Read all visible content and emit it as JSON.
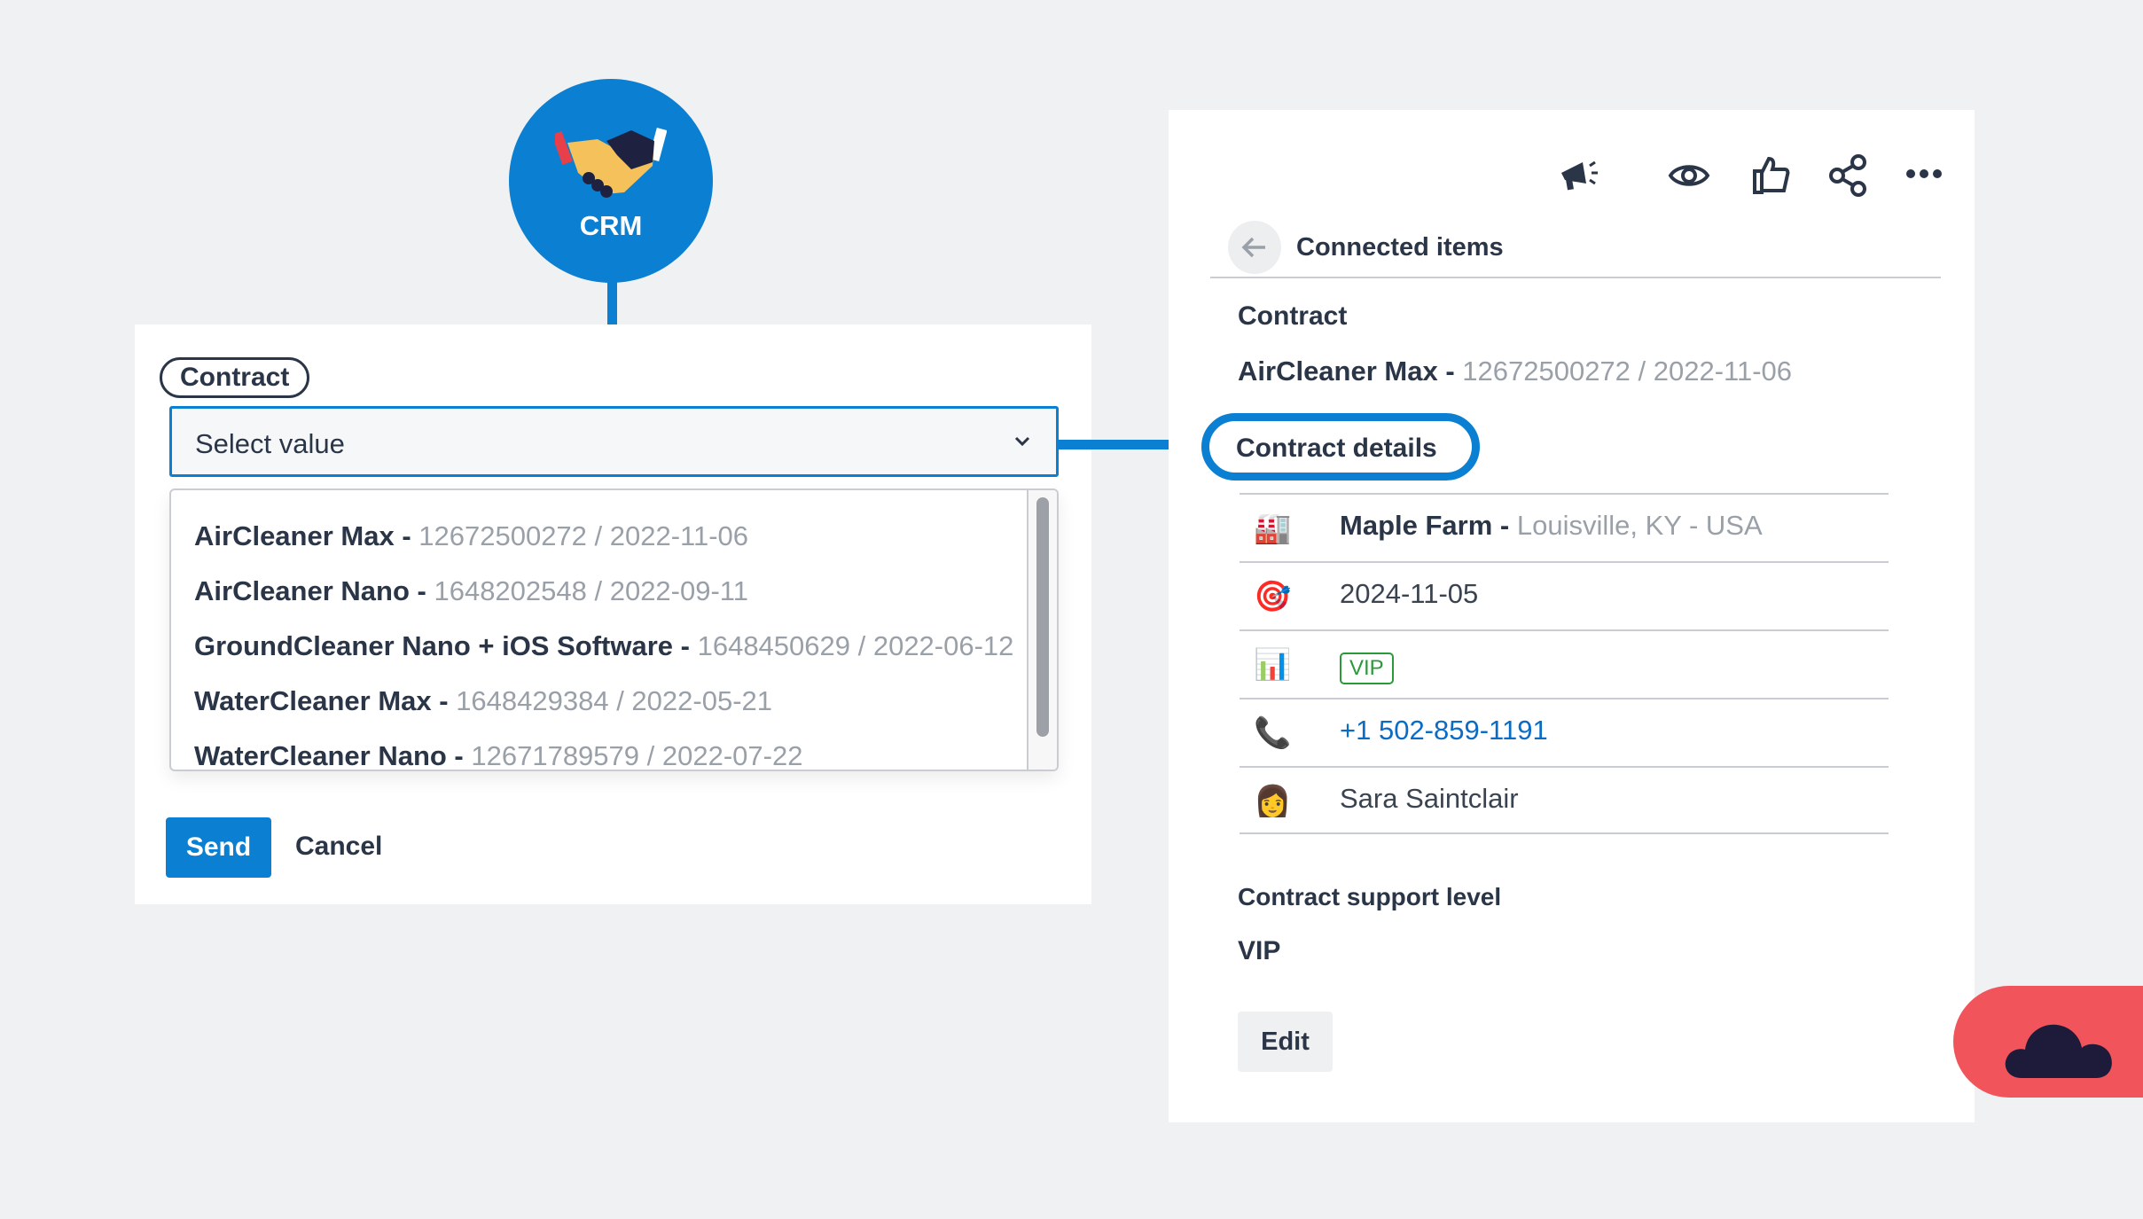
{
  "crm": {
    "label": "CRM",
    "icon": "handshake-icon"
  },
  "form": {
    "field_tag": "Contract",
    "select_placeholder": "Select value",
    "options": [
      {
        "name": "AirCleaner Max -",
        "meta": "12672500272 / 2022-11-06"
      },
      {
        "name": "AirCleaner Nano -",
        "meta": "1648202548 / 2022-09-11"
      },
      {
        "name": "GroundCleaner Nano + iOS Software -",
        "meta": "1648450629 / 2022-06-12"
      },
      {
        "name": "WaterCleaner Max -",
        "meta": "1648429384 / 2022-05-21"
      },
      {
        "name": "WaterCleaner Nano -",
        "meta": "12671789579 / 2022-07-22"
      }
    ],
    "send_label": "Send",
    "cancel_label": "Cancel"
  },
  "panel": {
    "toolbar_icons": [
      "megaphone-icon",
      "eye-icon",
      "thumbs-up-icon",
      "share-icon",
      "more-icon"
    ],
    "connected_title": "Connected items",
    "contract_label": "Contract",
    "contract_name": "AirCleaner Max -",
    "contract_meta": "12672500272 / 2022-11-06",
    "details_label": "Contract details",
    "details": {
      "company": {
        "icon": "🏭",
        "name": "Maple Farm -",
        "location": "Louisville, KY - USA"
      },
      "date": {
        "icon": "🎯",
        "value": "2024-11-05"
      },
      "level": {
        "icon": "📊",
        "badge": "VIP"
      },
      "phone": {
        "icon": "📞",
        "value": "+1 502-859-1191"
      },
      "contact": {
        "icon": "👩",
        "value": "Sara Saintclair"
      }
    },
    "support_label": "Contract support level",
    "support_value": "VIP",
    "edit_label": "Edit"
  },
  "colors": {
    "accent": "#0b7fd1",
    "cloud_tab": "#f2545b",
    "vip": "#2a9a39"
  }
}
